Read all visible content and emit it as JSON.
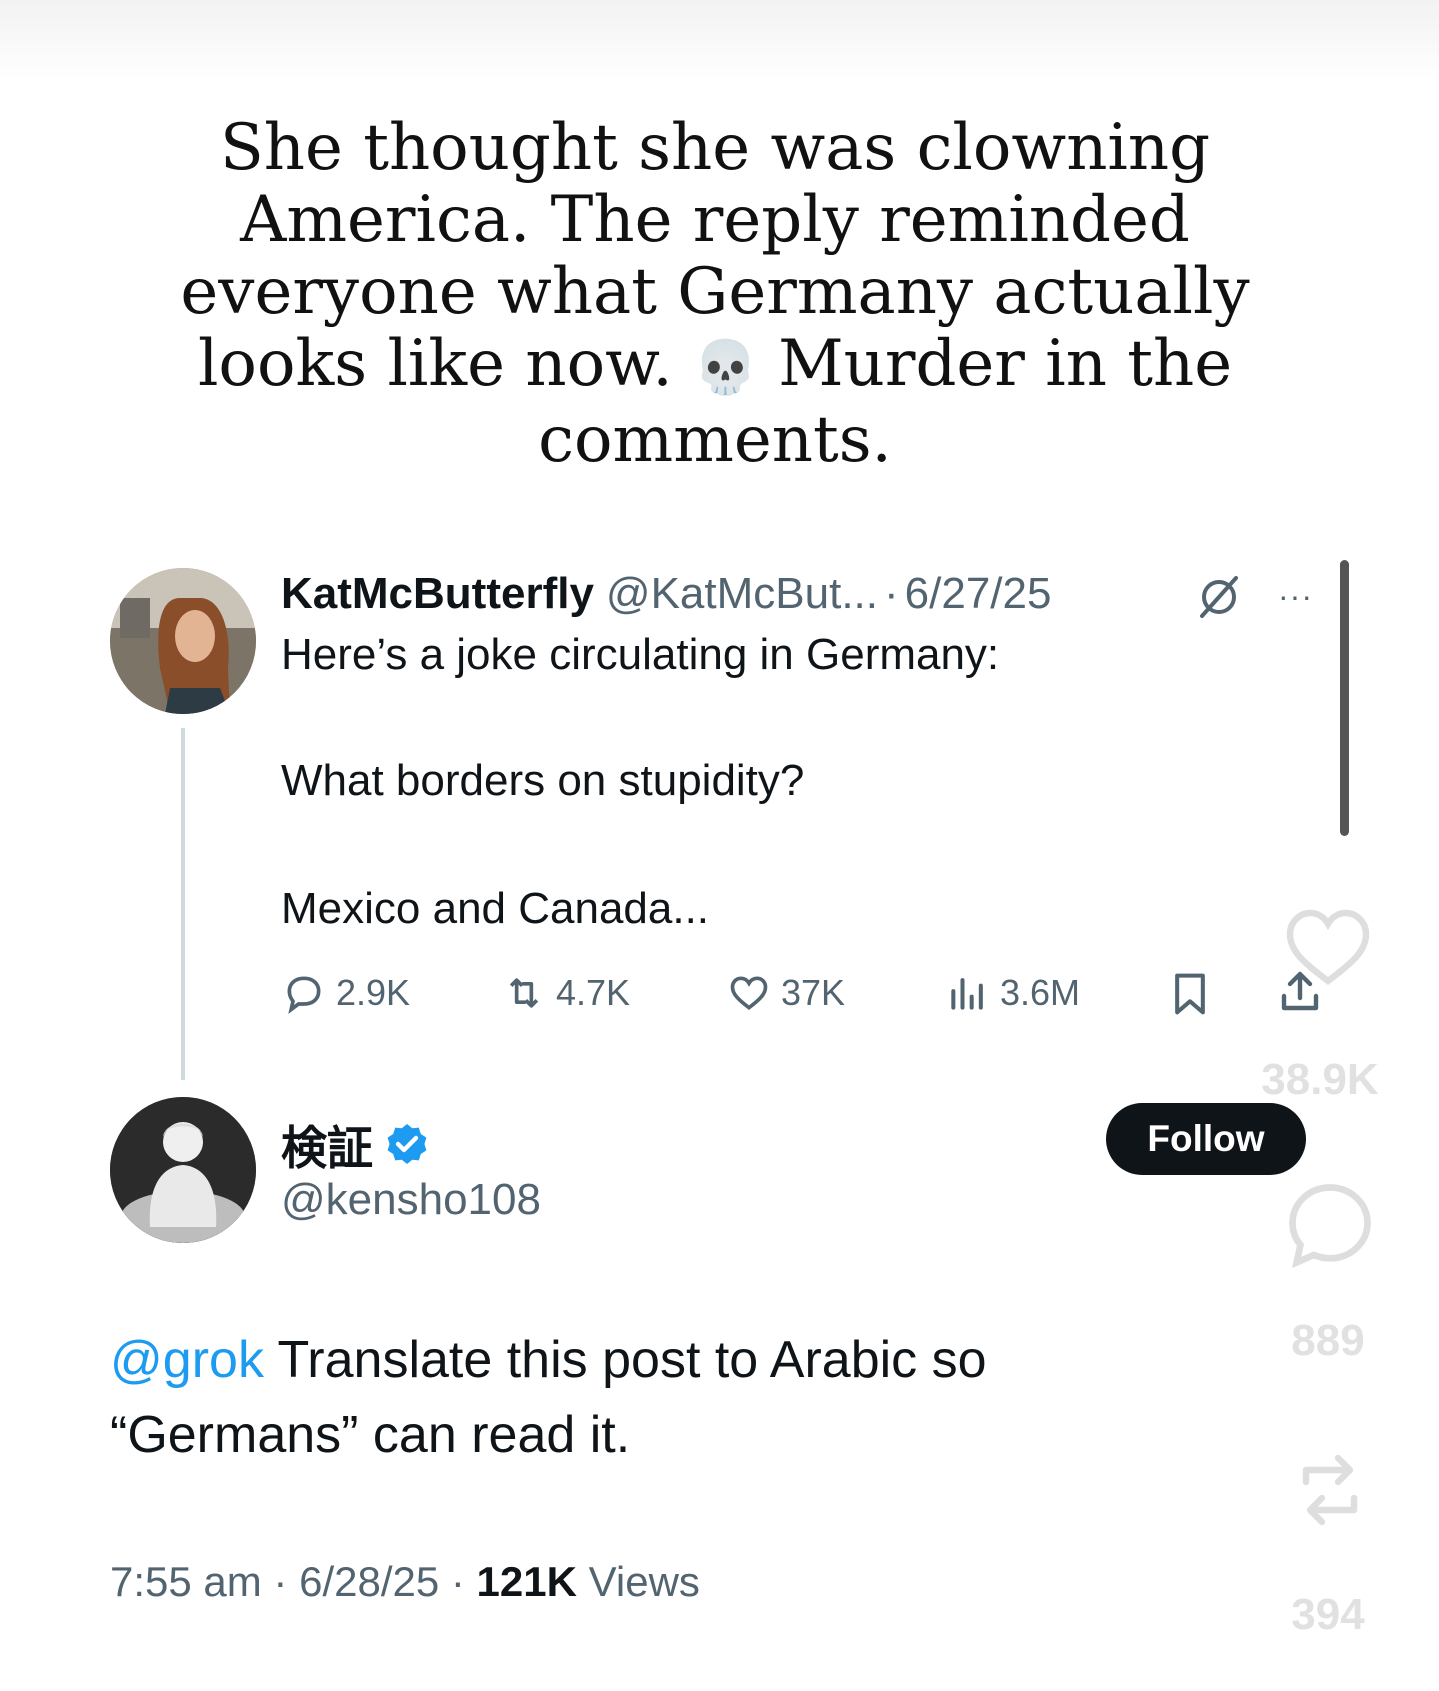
{
  "headline": {
    "line1": "She thought she was clowning",
    "line2": "America. The reply reminded",
    "line3": "everyone what Germany actually",
    "line4_a": "looks like now.",
    "emoji": "💀",
    "line4_b": "Murder in the",
    "line5": "comments."
  },
  "tweet1": {
    "name": "KatMcButterfly",
    "handle": "@KatMcBut...",
    "dot": "·",
    "date": "6/27/25",
    "more": "···",
    "text_line1": "Here’s a joke circulating in Germany:",
    "text_line2": "What borders on stupidity?",
    "text_line3": "Mexico and Canada...",
    "replies": "2.9K",
    "reposts": "4.7K",
    "likes": "37K",
    "views": "3.6M"
  },
  "tweet2": {
    "name": "検証",
    "handle": "@kensho108",
    "follow_label": "Follow",
    "mention": "@grok",
    "text_line1_rest": " Translate this post to Arabic so",
    "text_line2": "“Germans” can read it.",
    "meta_prefix": "7:55 am · 6/28/25 · ",
    "views_count": "121K",
    "views_label": " Views"
  },
  "overlay": {
    "like_count": "38.9K",
    "comment_count": "889",
    "repost_count": "394"
  },
  "colors": {
    "text": "#0f1419",
    "secondary": "#536471",
    "accent": "#1d9bf0",
    "follow_bg": "#0f1419"
  },
  "icons": [
    "skull-emoji",
    "grok-icon",
    "more-icon",
    "reply-icon",
    "retweet-icon",
    "heart-icon",
    "views-icon",
    "bookmark-icon",
    "share-icon",
    "verified-icon",
    "overlay-heart-icon",
    "overlay-comment-icon",
    "overlay-repost-icon"
  ]
}
